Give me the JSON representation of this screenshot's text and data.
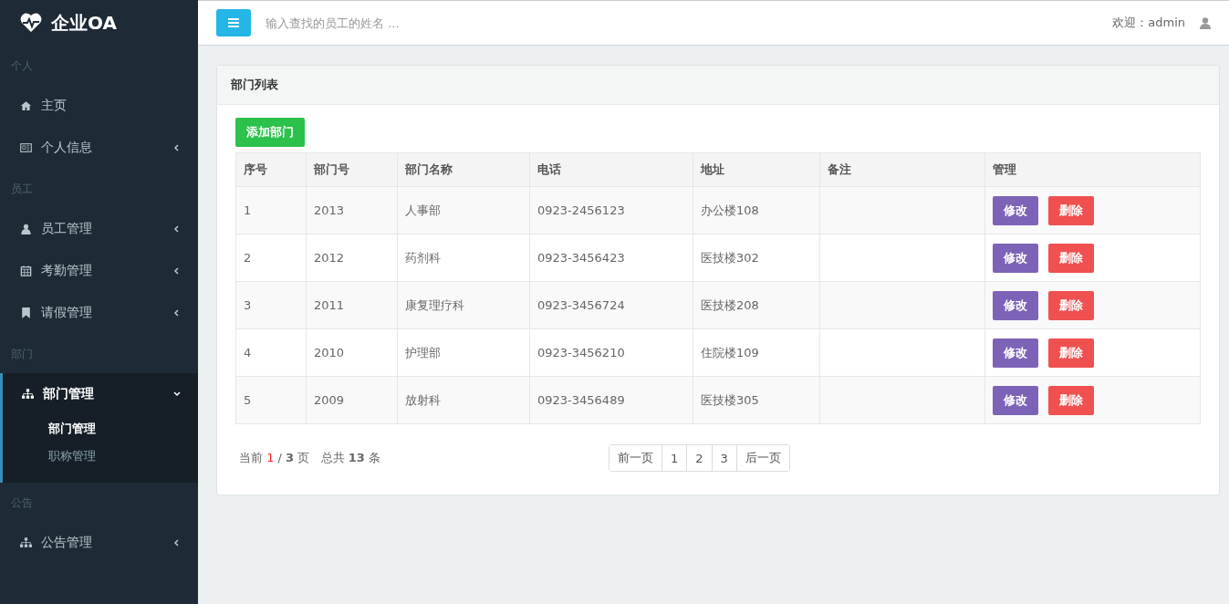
{
  "brand": {
    "title": "企业OA"
  },
  "sidebar": {
    "sections": [
      {
        "label": "个人",
        "items": [
          {
            "label": "主页",
            "kind": "home",
            "expandable": false,
            "expanded": false
          },
          {
            "label": "个人信息",
            "kind": "card",
            "expandable": true,
            "expanded": false
          }
        ]
      },
      {
        "label": "员工",
        "items": [
          {
            "label": "员工管理",
            "kind": "users",
            "expandable": true,
            "expanded": false
          },
          {
            "label": "考勤管理",
            "kind": "calendar",
            "expandable": true,
            "expanded": false
          },
          {
            "label": "请假管理",
            "kind": "bookmark",
            "expandable": true,
            "expanded": false
          }
        ]
      },
      {
        "label": "部门",
        "items": [
          {
            "label": "部门管理",
            "kind": "sitemap",
            "expandable": true,
            "expanded": true,
            "children": [
              {
                "label": "部门管理",
                "selected": true
              },
              {
                "label": "职称管理",
                "selected": false
              }
            ]
          }
        ]
      },
      {
        "label": "公告",
        "items": [
          {
            "label": "公告管理",
            "kind": "sitemap",
            "expandable": true,
            "expanded": false
          }
        ]
      }
    ]
  },
  "topbar": {
    "search": {
      "placeholder": "输入查找的员工的姓名 ..."
    },
    "welcome": "欢迎：admin"
  },
  "panel": {
    "title": "部门列表",
    "add_button": "添加部门",
    "table": {
      "columns": [
        "序号",
        "部门号",
        "部门名称",
        "电话",
        "地址",
        "备注",
        "管理"
      ],
      "rows": [
        {
          "cells": [
            "1",
            "2013",
            "人事部",
            "0923-2456123",
            "办公楼108",
            ""
          ],
          "edit": "修改",
          "delete": "删除"
        },
        {
          "cells": [
            "2",
            "2012",
            "药剂科",
            "0923-3456423",
            "医技楼302",
            ""
          ],
          "edit": "修改",
          "delete": "删除"
        },
        {
          "cells": [
            "3",
            "2011",
            "康复理疗科",
            "0923-3456724",
            "医技楼208",
            ""
          ],
          "edit": "修改",
          "delete": "删除"
        },
        {
          "cells": [
            "4",
            "2010",
            "护理部",
            "0923-3456210",
            "住院楼109",
            ""
          ],
          "edit": "修改",
          "delete": "删除"
        },
        {
          "cells": [
            "5",
            "2009",
            "放射科",
            "0923-3456489",
            "医技楼305",
            ""
          ],
          "edit": "修改",
          "delete": "删除"
        }
      ]
    },
    "pager_info": {
      "before": "当前",
      "current": "1",
      "after": "/ **3** 页   总共 **13** 条"
    },
    "pagination": [
      "前一页",
      "1",
      "2",
      "3",
      "后一页"
    ]
  }
}
